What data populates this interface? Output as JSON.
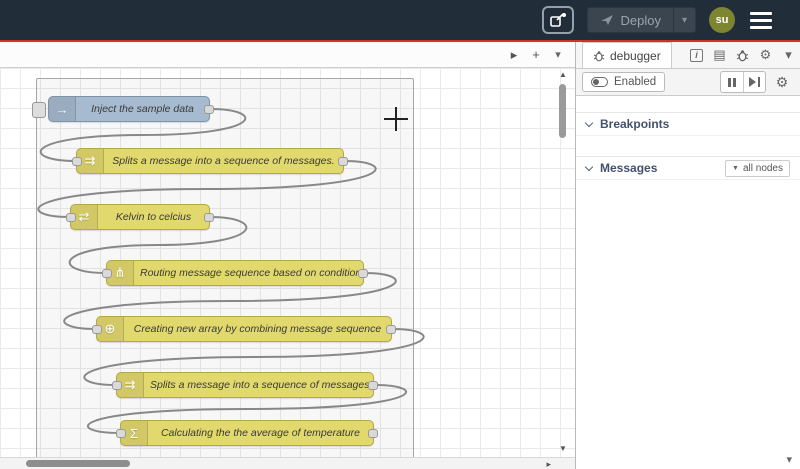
{
  "colors": {
    "header_bg": "#222d3a",
    "accent_red": "#d03232",
    "node_yellow": "#e2d96e",
    "node_inject_blue": "#a6bbcf",
    "avatar_bg": "#7d8531",
    "wire_gray": "#888888"
  },
  "icons": {
    "caret_down": "▾",
    "caret_right": "▸",
    "plus": "+",
    "scroll_up": "▲",
    "scroll_down": "▼",
    "book": "▤",
    "gear": "⚙",
    "info": "i",
    "filter": "▼"
  },
  "header": {
    "deploy_label": "Deploy",
    "avatar_initials": "su"
  },
  "workspace": {
    "nodes": [
      {
        "type": "inject",
        "label": "Inject the sample data",
        "glyph": "→"
      },
      {
        "type": "split",
        "label": "Splits a message into a sequence of messages.",
        "glyph": "⇉"
      },
      {
        "type": "function",
        "label": "Kelvin to celcius",
        "glyph": "⇄"
      },
      {
        "type": "switch",
        "label": "Routing message sequence based on condition",
        "glyph": "⋔"
      },
      {
        "type": "join",
        "label": "Creating new array by combining message sequence",
        "glyph": "⊕"
      },
      {
        "type": "split",
        "label": "Splits a message into a sequence of messages.",
        "glyph": "⇉"
      },
      {
        "type": "function",
        "label": "Calculating the the average of temperature",
        "glyph": "Σ"
      }
    ]
  },
  "sidebar": {
    "tab_label": "debugger",
    "enabled_label": "Enabled",
    "breakpoints_label": "Breakpoints",
    "messages_label": "Messages",
    "filter_label": "all nodes"
  }
}
